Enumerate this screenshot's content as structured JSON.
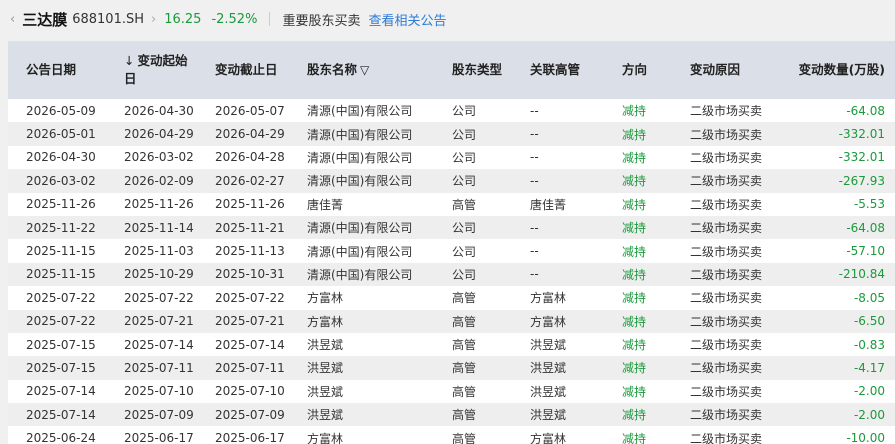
{
  "header": {
    "back_icon": "‹",
    "stock_name": "三达膜",
    "stock_code": "688101.SH",
    "chevron_icon": "›",
    "price": "16.25",
    "change": "-2.52%",
    "section_title": "重要股东买卖",
    "link": "查看相关公告"
  },
  "columns": [
    {
      "label": "公告日期"
    },
    {
      "label": "↓ 变动起始日",
      "sort_arrow": "↓",
      "text": "变动起始日"
    },
    {
      "label": "变动截止日"
    },
    {
      "label": "股东名称",
      "filter_icon": "▽"
    },
    {
      "label": "股东类型"
    },
    {
      "label": "关联高管"
    },
    {
      "label": "方向"
    },
    {
      "label": "变动原因"
    },
    {
      "label": "变动数量(万股)"
    }
  ],
  "rows": [
    [
      "2026-05-09",
      "2026-04-30",
      "2026-05-07",
      "清源(中国)有限公司",
      "公司",
      "--",
      "减持",
      "二级市场买卖",
      "-64.08"
    ],
    [
      "2026-05-01",
      "2026-04-29",
      "2026-04-29",
      "清源(中国)有限公司",
      "公司",
      "--",
      "减持",
      "二级市场买卖",
      "-332.01"
    ],
    [
      "2026-04-30",
      "2026-03-02",
      "2026-04-28",
      "清源(中国)有限公司",
      "公司",
      "--",
      "减持",
      "二级市场买卖",
      "-332.01"
    ],
    [
      "2026-03-02",
      "2026-02-09",
      "2026-02-27",
      "清源(中国)有限公司",
      "公司",
      "--",
      "减持",
      "二级市场买卖",
      "-267.93"
    ],
    [
      "2025-11-26",
      "2025-11-26",
      "2025-11-26",
      "唐佳菁",
      "高管",
      "唐佳菁",
      "减持",
      "二级市场买卖",
      "-5.53"
    ],
    [
      "2025-11-22",
      "2025-11-14",
      "2025-11-21",
      "清源(中国)有限公司",
      "公司",
      "--",
      "减持",
      "二级市场买卖",
      "-64.08"
    ],
    [
      "2025-11-15",
      "2025-11-03",
      "2025-11-13",
      "清源(中国)有限公司",
      "公司",
      "--",
      "减持",
      "二级市场买卖",
      "-57.10"
    ],
    [
      "2025-11-15",
      "2025-10-29",
      "2025-10-31",
      "清源(中国)有限公司",
      "公司",
      "--",
      "减持",
      "二级市场买卖",
      "-210.84"
    ],
    [
      "2025-07-22",
      "2025-07-22",
      "2025-07-22",
      "方富林",
      "高管",
      "方富林",
      "减持",
      "二级市场买卖",
      "-8.05"
    ],
    [
      "2025-07-22",
      "2025-07-21",
      "2025-07-21",
      "方富林",
      "高管",
      "方富林",
      "减持",
      "二级市场买卖",
      "-6.50"
    ],
    [
      "2025-07-15",
      "2025-07-14",
      "2025-07-14",
      "洪昱斌",
      "高管",
      "洪昱斌",
      "减持",
      "二级市场买卖",
      "-0.83"
    ],
    [
      "2025-07-15",
      "2025-07-11",
      "2025-07-11",
      "洪昱斌",
      "高管",
      "洪昱斌",
      "减持",
      "二级市场买卖",
      "-4.17"
    ],
    [
      "2025-07-14",
      "2025-07-10",
      "2025-07-10",
      "洪昱斌",
      "高管",
      "洪昱斌",
      "减持",
      "二级市场买卖",
      "-2.00"
    ],
    [
      "2025-07-14",
      "2025-07-09",
      "2025-07-09",
      "洪昱斌",
      "高管",
      "洪昱斌",
      "减持",
      "二级市场买卖",
      "-2.00"
    ],
    [
      "2025-06-24",
      "2025-06-17",
      "2025-06-17",
      "方富林",
      "高管",
      "方富林",
      "减持",
      "二级市场买卖",
      "-10.00"
    ]
  ],
  "colors": {
    "negative": "#1a9a3c",
    "link": "#2b7ad8",
    "header_bg": "#dbe0e8"
  }
}
